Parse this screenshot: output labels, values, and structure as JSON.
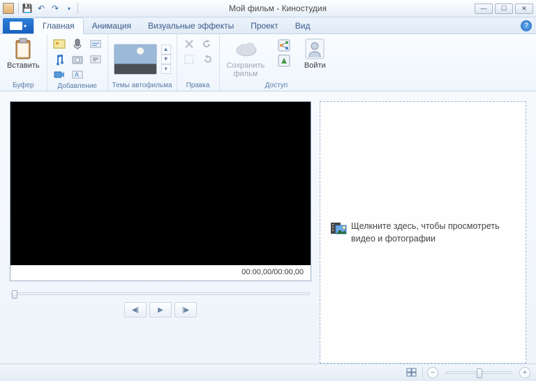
{
  "title": "Мой фильм - Киностудия",
  "tabs": {
    "home": "Главная",
    "animation": "Анимация",
    "effects": "Визуальные эффекты",
    "project": "Проект",
    "view": "Вид"
  },
  "ribbon": {
    "buffer": {
      "paste": "Вставить",
      "group": "Буфер"
    },
    "add": {
      "group": "Добавление"
    },
    "themes": {
      "group": "Темы автофильма"
    },
    "edit": {
      "group": "Правка"
    },
    "access": {
      "save": "Сохранить\nфильм",
      "signin": "Войти",
      "group": "Доступ"
    }
  },
  "player": {
    "timecode": "00:00,00/00:00,00"
  },
  "drop": {
    "text": "Щелкните здесь, чтобы просмотреть видео и фотографии"
  }
}
